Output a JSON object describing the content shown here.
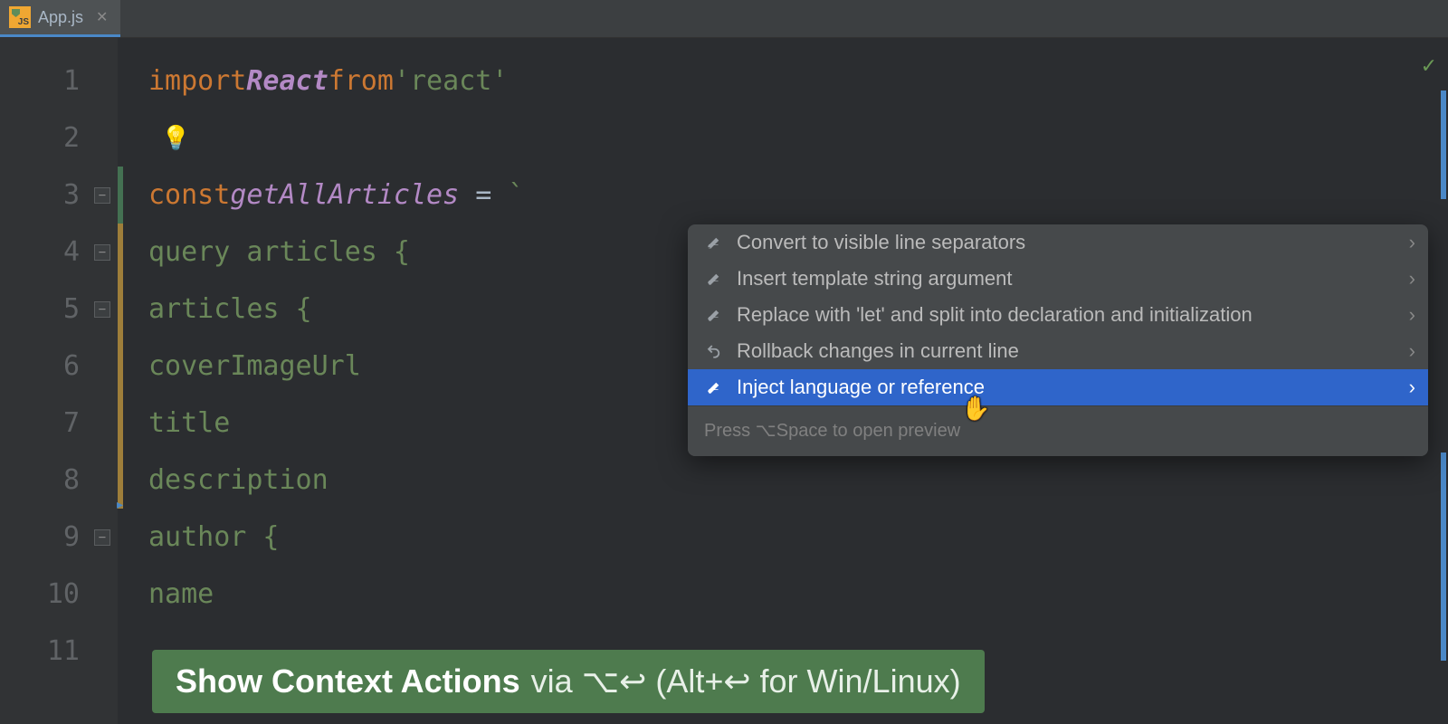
{
  "tab": {
    "filename": "App.js",
    "icon_text": "JS"
  },
  "lines": [
    "1",
    "2",
    "3",
    "4",
    "5",
    "6",
    "7",
    "8",
    "9",
    "10",
    "11"
  ],
  "code": {
    "import_kw": "import",
    "import_name": "React",
    "from_kw": "from",
    "import_path": "'react'",
    "const_kw": "const",
    "fn_name": "getAllArticles",
    "eq": " = ",
    "backtick": "`",
    "l4": "query articles {",
    "l5": "articles {",
    "l6": "coverImageUrl",
    "l7": "title",
    "l8": "description",
    "l9": "author {",
    "l10": "name"
  },
  "bulb": "💡",
  "popup": {
    "items": [
      "Convert to visible line separators",
      "Insert template string argument",
      "Replace with 'let' and split into declaration and initialization",
      "Rollback changes in current line",
      "Inject language or reference"
    ],
    "hint": "Press ⌥Space to open preview"
  },
  "banner": {
    "bold": "Show Context Actions",
    "rest": "via ⌥↩ (Alt+↩ for Win/Linux)"
  },
  "status_check": "✓"
}
